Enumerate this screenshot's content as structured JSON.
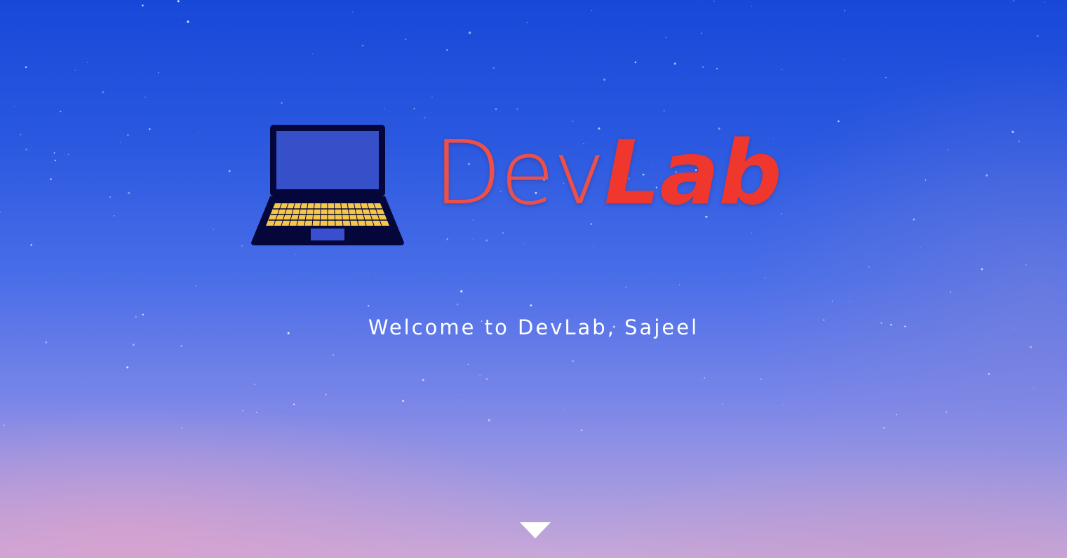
{
  "brand": {
    "name_part1": "Dev",
    "name_part2": "Lab",
    "primary_color": "#f0372e",
    "icon": "laptop-icon"
  },
  "hero": {
    "welcome_text": "Welcome to DevLab, Sajeel",
    "scroll_icon": "triangle-down-icon"
  },
  "colors": {
    "sky_top": "#1848d8",
    "sky_bottom": "#c8a8d8",
    "laptop_body": "#05063a",
    "keyboard": "#f5c84a",
    "text": "#ffffff"
  }
}
